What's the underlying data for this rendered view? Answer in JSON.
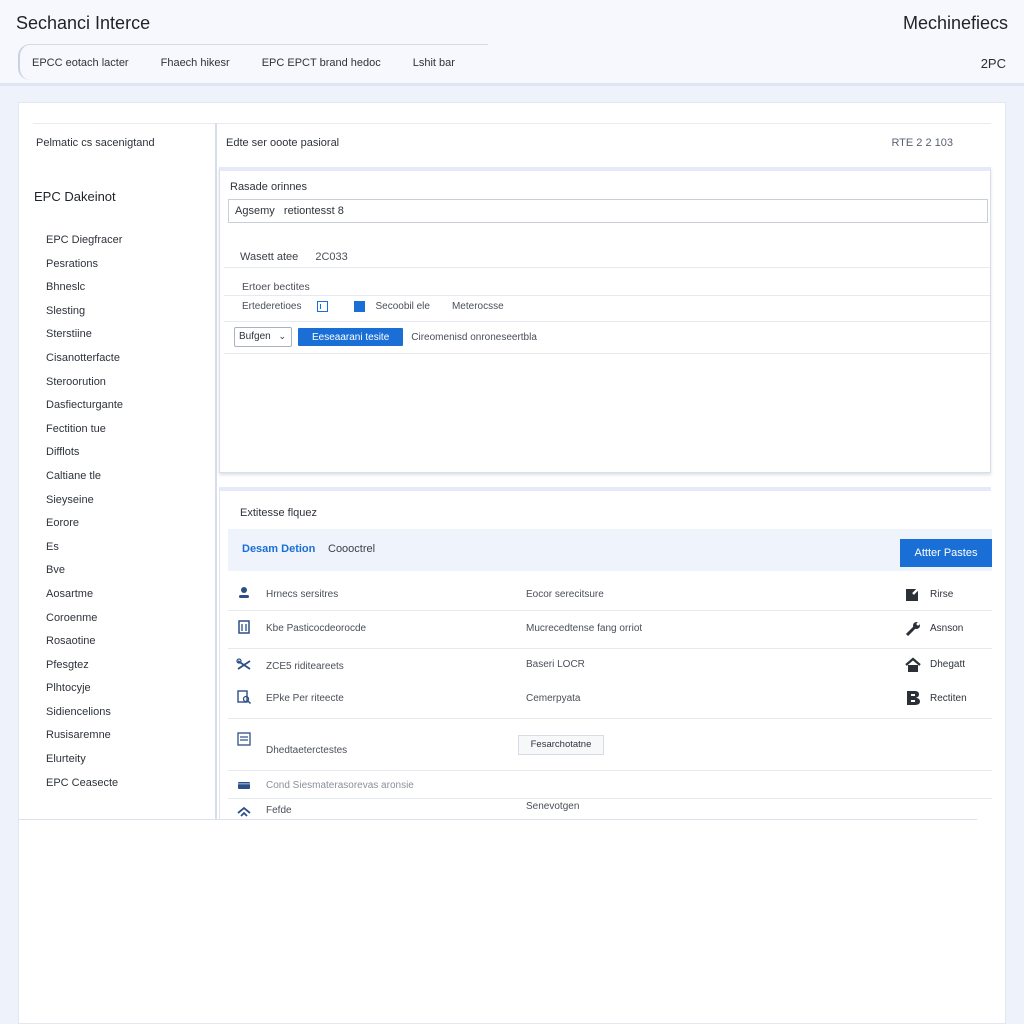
{
  "header": {
    "title": "Sechanci Interce",
    "right_title": "Mechinefiecs",
    "tabs": [
      {
        "label": "EPCC eotach lacter"
      },
      {
        "label": "Fhaech hikesr"
      },
      {
        "label": "EPC EPCT brand hedoc"
      },
      {
        "label": "Lshit bar"
      }
    ],
    "code": "2PC"
  },
  "sidebar": {
    "caption": "Pelmatic cs sacenigtand",
    "heading": "EPC Dakeinot",
    "items": [
      "EPC Diegfracer",
      "Pesrations",
      "Bhneslc",
      "Slesting",
      "Sterstiine",
      "Cisanotterfacte",
      "Steroorution",
      "Dasfiecturgante",
      "Fectition tue",
      "Difflots",
      "Caltiane tle",
      "Sieyseine",
      "Eorore",
      "Es",
      "Bve",
      "Aosartme",
      "Coroenme",
      "Rosaotine",
      "Pfesgtez",
      "Plhtocyje",
      "Sidiencelions",
      "Rusisaremne",
      "Elurteity",
      "EPC Ceasecte"
    ]
  },
  "form": {
    "caption": "Edte ser ooote pasioral",
    "meta": "RTE 2 2 103",
    "input_label": "Rasade orinnes",
    "input_value": "Agsemy   retiontesst 8",
    "row1_label": "Wasett atee",
    "row1_value": "2C033",
    "sub_label": "Ertoer bectites",
    "options": [
      "Ertederetioes",
      "Secoobil ele",
      "Meterocsse"
    ],
    "select_value": "Bufgen",
    "button_label": "Eeseaarani tesite",
    "hint": "Cireomenisd onroneseertbla"
  },
  "table": {
    "caption": "Extitesse flquez",
    "tab_active": "Desam Detion",
    "tab_other": "Coooctrel",
    "primary_button": "Attter Pastes",
    "rows": [
      {
        "icon": "user-icon",
        "col1": "Hrnecs sersitres",
        "col2": "Eocor serecitsure",
        "action_icon": "edit-icon",
        "action": "Rirse"
      },
      {
        "icon": "document-icon",
        "col1": "Kbe Pasticocdeorocde",
        "col2": "Mucrecedtense fang orriot",
        "action_icon": "wrench-icon",
        "action": "Asnson"
      },
      {
        "icon": "tools-icon",
        "col1": "ZCE5 riditeareets",
        "col2": "Baseri LOCR",
        "action_icon": "home-icon",
        "action": "Dhegatt"
      },
      {
        "icon": "file-search-icon",
        "col1": "EPke Per riteecte",
        "col2": "Cemerpyata",
        "action_icon": "b-icon",
        "action": "Rectiten"
      },
      {
        "icon": "list-icon",
        "col1": "Dhedtaeterctestes",
        "chip": "Fesarchotatne"
      },
      {
        "icon": "card-icon",
        "col1": "Cond Siesmaterasorevas aronsie"
      },
      {
        "icon": "signal-icon",
        "col1": "Fefde",
        "col2": "Senevotgen"
      }
    ]
  },
  "colors": {
    "accent": "#1a6fd6",
    "header_bg": "#f6f8fd",
    "page_bg": "#eef2fa"
  }
}
